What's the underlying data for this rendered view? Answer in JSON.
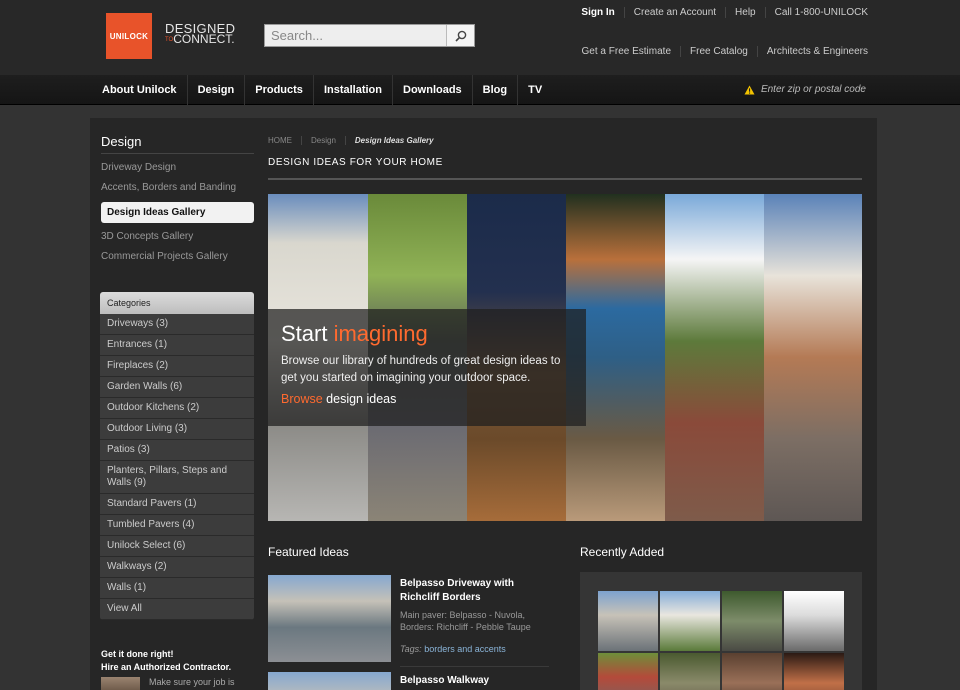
{
  "header": {
    "logo_text": "UNILOCK",
    "tagline_l1": "DESIGNED",
    "tagline_to": "TO",
    "tagline_l2": "CONNECT.",
    "search_placeholder": "Search...",
    "top_links": [
      "Sign In",
      "Create an Account",
      "Help",
      "Call 1-800-UNILOCK"
    ],
    "secondary_links": [
      "Get a Free Estimate",
      "Free Catalog",
      "Architects & Engineers"
    ]
  },
  "nav": {
    "items": [
      "About Unilock",
      "Design",
      "Products",
      "Installation",
      "Downloads",
      "Blog",
      "TV"
    ],
    "zip_text": "Enter zip or postal code"
  },
  "sidebar": {
    "title": "Design",
    "links": [
      "Driveway Design",
      "Accents, Borders and Banding",
      "Design Ideas Gallery",
      "3D Concepts Gallery",
      "Commercial Projects Gallery"
    ],
    "categories_title": "Categories",
    "categories": [
      "Driveways (3)",
      "Entrances (1)",
      "Fireplaces (2)",
      "Garden Walls (6)",
      "Outdoor Kitchens (2)",
      "Outdoor Living (3)",
      "Patios (3)",
      "Planters, Pillars, Steps and Walls (9)",
      "Standard Pavers (1)",
      "Tumbled Pavers (4)",
      "Unilock Select (6)",
      "Walkways (2)",
      "Walls (1)",
      "View All"
    ],
    "contractor_l1": "Get it done right!",
    "contractor_l2": "Hire an Authorized Contractor.",
    "contractor_text": "Make sure your job is"
  },
  "breadcrumb": [
    "HOME",
    "Design",
    "Design Ideas Gallery"
  ],
  "main": {
    "title": "DESIGN IDEAS FOR YOUR HOME",
    "overlay": {
      "title_plain": "Start ",
      "title_accent": "imagining",
      "text": "Browse our library of hundreds of great design ideas to get you started on imagining your outdoor space.",
      "link_accent": "Browse",
      "link_plain": " design ideas"
    },
    "featured_title": "Featured Ideas",
    "featured": [
      {
        "name": "Belpasso Driveway with Richcliff Borders",
        "desc": "Main paver: Belpasso - Nuvola, Borders: Richcliff - Pebble Taupe",
        "tags_label": "Tags:",
        "tags": "borders and accents"
      },
      {
        "name": "Belpasso Walkway"
      }
    ],
    "recent_title": "Recently Added"
  },
  "colors": {
    "accent": "#ff6a2f",
    "logo_bg": "#e8532a",
    "background": "#333333",
    "panel": "#262626"
  }
}
